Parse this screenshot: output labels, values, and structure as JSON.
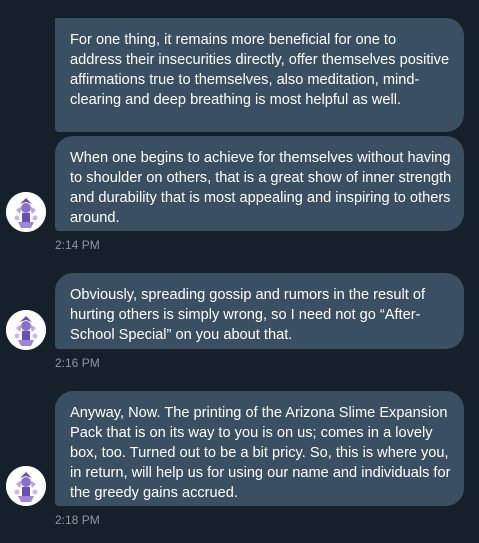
{
  "conversation": {
    "messages": [
      {
        "text": "For one thing, it remains more beneficial for one to address their insecurities directly, offer themselves positive affirmations true to themselves, also meditation, mind-clearing and deep breathing is most helpful as well."
      },
      {
        "text": "When one begins to achieve for themselves without having to shoulder on others, that is a great show of inner strength and durability that is most appealing and inspiring to others around.",
        "timestamp": "2:14 PM"
      },
      {
        "text": "Obviously, spreading gossip and rumors in the result of hurting others is simply wrong, so I need not go “After-School Special” on you about that.",
        "timestamp": "2:16 PM"
      },
      {
        "text": "Anyway, Now.  The printing of the Arizona Slime Expansion Pack that is on its way to you is on us; comes in a lovely box, too.  Turned out to be a bit pricy.  So, this is where you, in return, will help us for using our name and individuals for the greedy gains accrued.",
        "timestamp": "2:18 PM"
      }
    ]
  },
  "colors": {
    "background": "#15202b",
    "bubble": "#3b4f63",
    "text": "#ffffff",
    "timestamp": "#8b98a5",
    "avatar_accent": "#6a4fb0"
  }
}
